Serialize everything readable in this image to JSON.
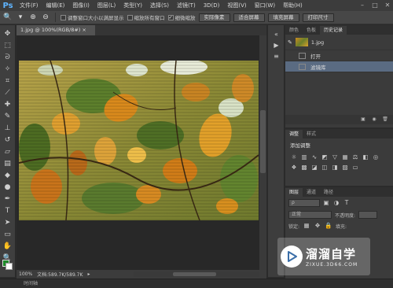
{
  "app": {
    "logo": "Ps"
  },
  "menu": [
    "文件(F)",
    "编辑(E)",
    "图像(I)",
    "图层(L)",
    "类型(Y)",
    "选择(S)",
    "滤镜(T)",
    "3D(D)",
    "视图(V)",
    "窗口(W)",
    "帮助(H)"
  ],
  "options": {
    "resize_windows_label": "调整窗口大小以满屏显示",
    "zoom_all_label": "缩放所有窗口",
    "scrubby_zoom_label": "细微缩放",
    "scrubby_zoom_checked": true,
    "actual_pixels_btn": "实际像素",
    "fit_screen_btn": "适合屏幕",
    "fill_screen_btn": "填充屏幕",
    "print_size_btn": "打印尺寸"
  },
  "document": {
    "tab_title": "1.jpg @ 100%(RGB/8#)",
    "zoom": "100%",
    "doc_size": "文档:589.7K/589.7K",
    "timeline": "时间轴"
  },
  "history_panel": {
    "tabs": [
      "颜色",
      "色板",
      "历史记录"
    ],
    "active_tab": "历史记录",
    "snapshot_name": "1.jpg",
    "states": [
      "打开",
      "滤镜库"
    ],
    "selected_state": "滤镜库"
  },
  "adjustments_panel": {
    "tabs": [
      "调整",
      "样式"
    ],
    "title": "添加调整"
  },
  "layers_panel": {
    "tabs": [
      "图层",
      "通道",
      "路径"
    ],
    "blend_mode": "正常",
    "opacity_label": "不透明度:",
    "lock_label": "锁定:",
    "fill_label": "填充:"
  },
  "watermark": {
    "main": "溜溜自学",
    "sub": "ZIXUE.3D66.COM"
  },
  "colors": {
    "accent": "#5fb4ff",
    "foreground": "#1e8a2a",
    "selected_row": "#5a6b82"
  }
}
